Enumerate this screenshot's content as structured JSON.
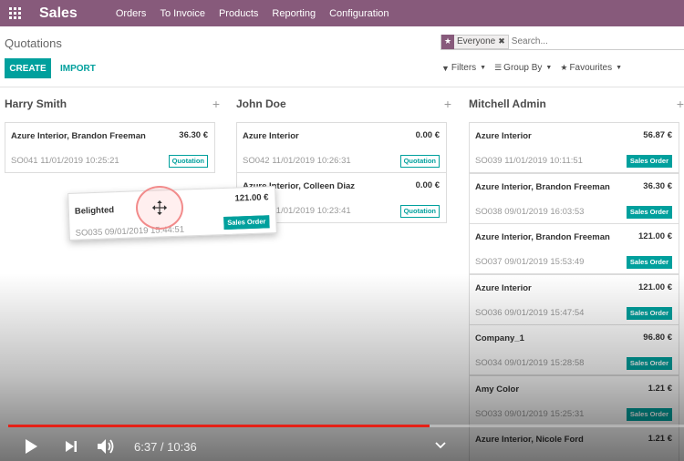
{
  "navbar": {
    "brand": "Sales",
    "menu": [
      "Orders",
      "To Invoice",
      "Products",
      "Reporting",
      "Configuration"
    ]
  },
  "control_panel": {
    "title": "Quotations",
    "create_label": "CREATE",
    "import_label": "IMPORT",
    "search": {
      "facet_label": "Everyone",
      "placeholder": "Search..."
    },
    "filters_label": "Filters",
    "groupby_label": "Group By",
    "favourites_label": "Favourites"
  },
  "columns": [
    {
      "title": "Harry Smith",
      "cards": [
        {
          "name": "Azure Interior, Brandon Freeman",
          "amount": "36.30 €",
          "ref": "SO041 11/01/2019 10:25:21",
          "status": "Quotation"
        }
      ]
    },
    {
      "title": "John Doe",
      "cards": [
        {
          "name": "Azure Interior",
          "amount": "0.00 €",
          "ref": "SO042 11/01/2019 10:26:31",
          "status": "Quotation"
        },
        {
          "name": "Azure Interior, Colleen Diaz",
          "amount": "0.00 €",
          "ref": "SO040 11/01/2019 10:23:41",
          "status": "Quotation"
        }
      ]
    },
    {
      "title": "Mitchell Admin",
      "cards": [
        {
          "name": "Azure Interior",
          "amount": "56.87 €",
          "ref": "SO039 11/01/2019 10:11:51",
          "status": "Sales Order"
        },
        {
          "name": "Azure Interior, Brandon Freeman",
          "amount": "36.30 €",
          "ref": "SO038 09/01/2019 16:03:53",
          "status": "Sales Order"
        },
        {
          "name": "Azure Interior, Brandon Freeman",
          "amount": "121.00 €",
          "ref": "SO037 09/01/2019 15:53:49",
          "status": "Sales Order"
        },
        {
          "name": "Azure Interior",
          "amount": "121.00 €",
          "ref": "SO036 09/01/2019 15:47:54",
          "status": "Sales Order"
        },
        {
          "name": "Company_1",
          "amount": "96.80 €",
          "ref": "SO034 09/01/2019 15:28:58",
          "status": "Sales Order"
        },
        {
          "name": "Amy Color",
          "amount": "1.21 €",
          "ref": "SO033 09/01/2019 15:25:31",
          "status": "Sales Order"
        },
        {
          "name": "Azure Interior, Nicole Ford",
          "amount": "1.21 €",
          "ref": "",
          "status": ""
        }
      ]
    }
  ],
  "dragged_card": {
    "name": "Belighted",
    "amount": "121.00 €",
    "ref": "SO035 09/01/2019 15:44:51",
    "status": "Sales Order"
  },
  "video_player": {
    "time": "6:37 / 10:36",
    "progress": 0.624,
    "progress_color": "#e62117"
  }
}
